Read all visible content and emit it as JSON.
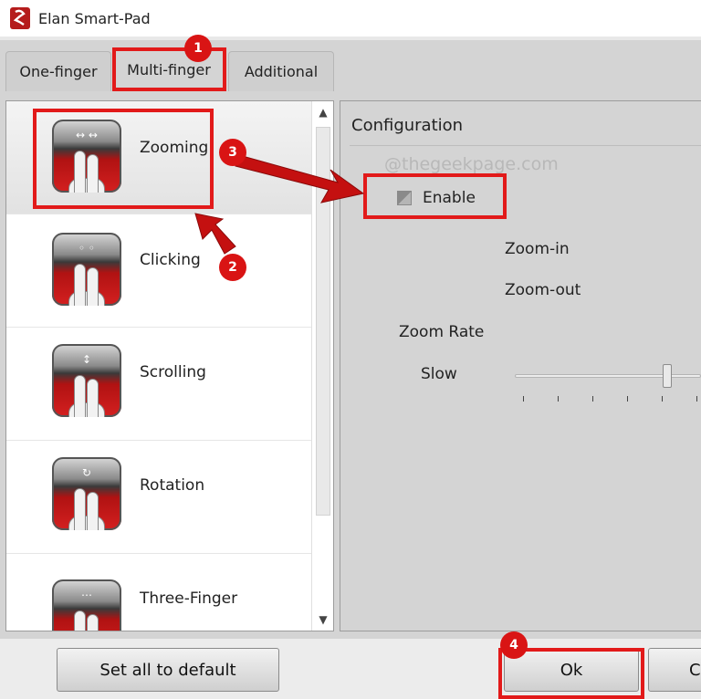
{
  "window": {
    "title": "Elan Smart-Pad"
  },
  "tabs": [
    {
      "label": "One-finger"
    },
    {
      "label": "Multi-finger",
      "active": true
    },
    {
      "label": "Additional"
    }
  ],
  "gestures": [
    {
      "label": "Zooming",
      "selected": true
    },
    {
      "label": "Clicking"
    },
    {
      "label": "Scrolling"
    },
    {
      "label": "Rotation"
    },
    {
      "label": "Three-Finger"
    }
  ],
  "configuration": {
    "title": "Configuration",
    "watermark": "@thegeekpage.com",
    "enable_label": "Enable",
    "zoom_in_label": "Zoom-in",
    "zoom_out_label": "Zoom-out",
    "zoom_rate_label": "Zoom Rate",
    "slow_label": "Slow",
    "zoom_rate_level": 0.45
  },
  "buttons": {
    "set_default": "Set all to default",
    "ok": "Ok",
    "cancel_partial": "C"
  },
  "annotations": [
    "1",
    "2",
    "3",
    "4"
  ],
  "colors": {
    "highlight": "#e21a1a",
    "panel_bg": "#d4d4d4",
    "icon_red": "#c81818"
  }
}
